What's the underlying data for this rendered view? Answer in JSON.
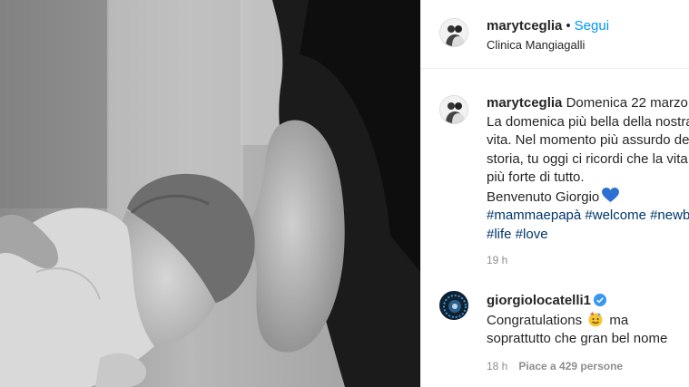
{
  "header": {
    "username": "marytceglia",
    "separator": "•",
    "follow_label": "Segui",
    "location": "Clinica Mangiagalli"
  },
  "caption": {
    "username": "marytceglia",
    "lines": [
      "Domenica 22 marzo",
      "La domenica più bella della nostra",
      "vita. Nel momento più assurdo de",
      "storia, tu oggi ci ricordi che la vita",
      "più forte di tutto.",
      "Benvenuto Giorgio"
    ],
    "hashtags_line1": "#mammaepapà #welcome #newb",
    "hashtags_line2": "#life #love",
    "time": "19 h",
    "heart_color": "#2d6fd2"
  },
  "comment": {
    "username": "giorgiolocatelli1",
    "text_before_emoji": "Congratulations",
    "text_after_emoji": "ma",
    "text_line2": "soprattutto che gran bel nome",
    "time": "18 h",
    "likes": "Piace a 429 persone"
  },
  "colors": {
    "link_blue": "#0095f6",
    "hashtag": "#00376b",
    "muted": "#8e8e8e"
  }
}
